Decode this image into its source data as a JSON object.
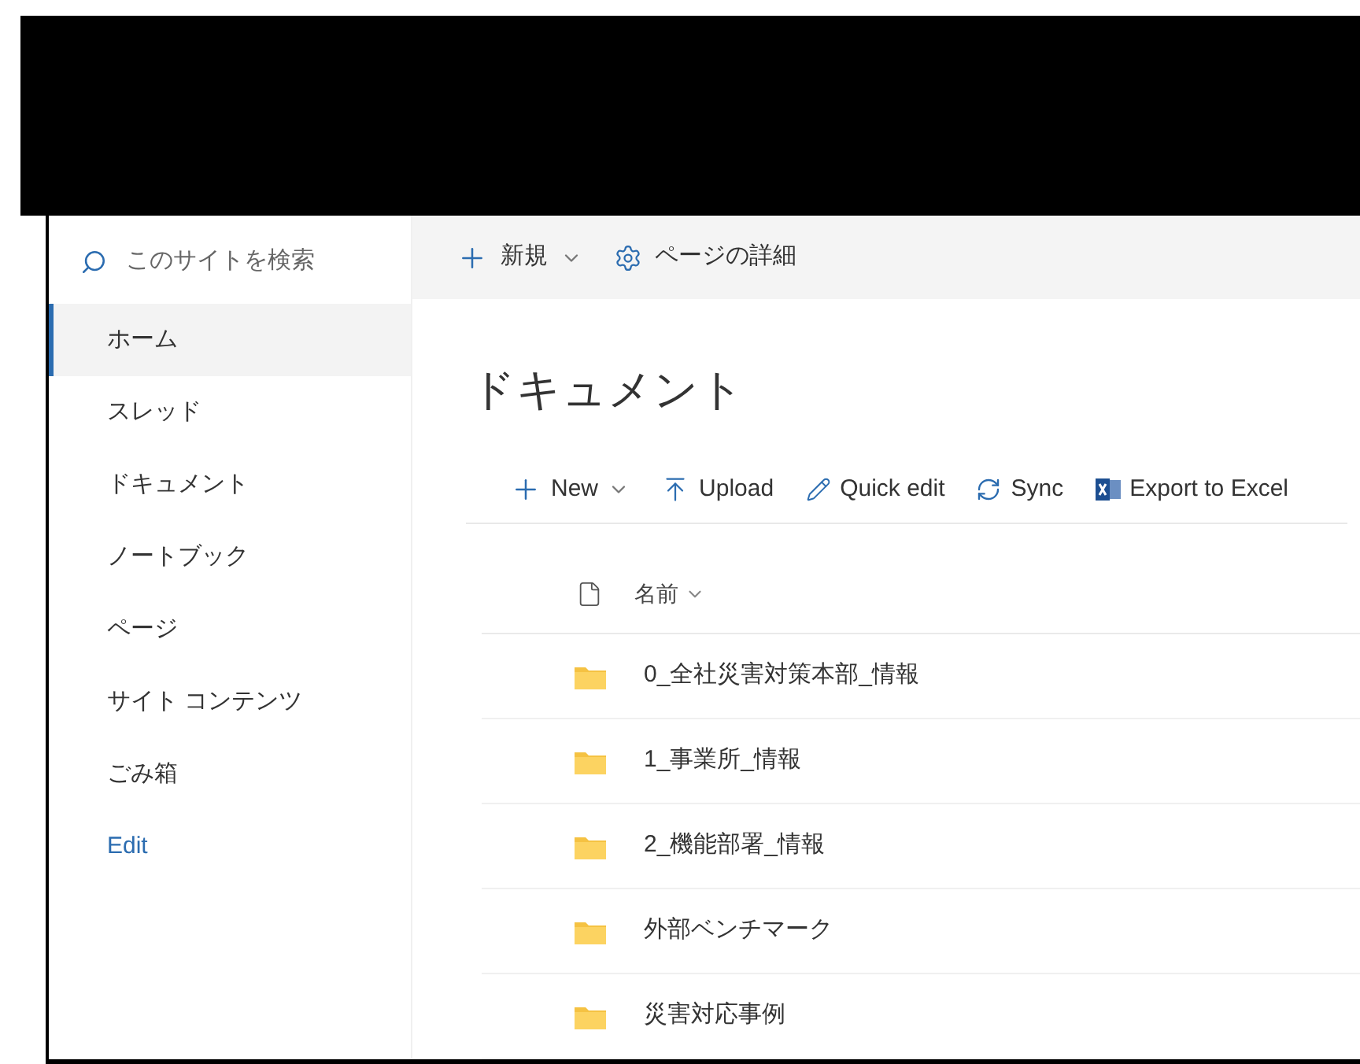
{
  "sidebar": {
    "search": {
      "placeholder": "このサイトを検索"
    },
    "items": [
      {
        "label": "ホーム",
        "selected": true,
        "kind": "nav"
      },
      {
        "label": "スレッド",
        "selected": false,
        "kind": "nav"
      },
      {
        "label": "ドキュメント",
        "selected": false,
        "kind": "nav"
      },
      {
        "label": "ノートブック",
        "selected": false,
        "kind": "nav"
      },
      {
        "label": "ページ",
        "selected": false,
        "kind": "nav"
      },
      {
        "label": "サイト コンテンツ",
        "selected": false,
        "kind": "nav"
      },
      {
        "label": "ごみ箱",
        "selected": false,
        "kind": "nav"
      },
      {
        "label": "Edit",
        "selected": false,
        "kind": "link"
      }
    ]
  },
  "command_bar": {
    "new": "新規",
    "page_details": "ページの詳細"
  },
  "title": "ドキュメント",
  "toolbar": [
    {
      "kind": "new",
      "label": "New"
    },
    {
      "kind": "upload",
      "label": "Upload"
    },
    {
      "kind": "edit",
      "label": "Quick edit"
    },
    {
      "kind": "sync",
      "label": "Sync"
    },
    {
      "kind": "excel",
      "label": "Export to Excel"
    }
  ],
  "table": {
    "columns": [
      {
        "label": "名前"
      }
    ],
    "rows": [
      {
        "name": "0_全社災害対策本部_情報"
      },
      {
        "name": "1_事業所_情報"
      },
      {
        "name": "2_機能部署_情報"
      },
      {
        "name": "外部ベンチマーク"
      },
      {
        "name": "災害対応事例"
      }
    ]
  }
}
